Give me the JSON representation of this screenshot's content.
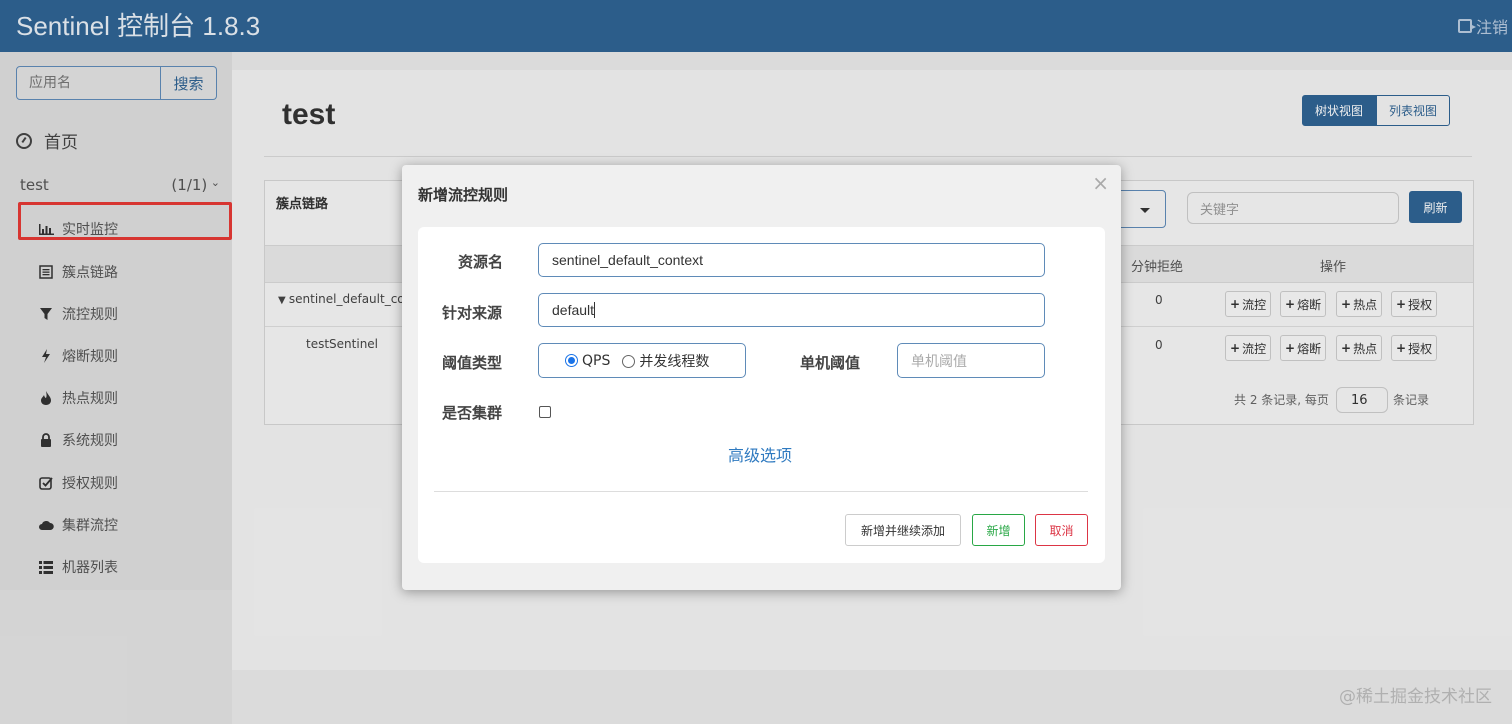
{
  "header": {
    "title": "Sentinel 控制台 1.8.3",
    "logout_label": "注销"
  },
  "sidebar": {
    "search_placeholder": "应用名",
    "search_button": "搜索",
    "home_label": "首页",
    "app": {
      "name": "test",
      "count": "(1/1)"
    },
    "items": [
      {
        "label": "实时监控",
        "icon": "bar-chart-icon"
      },
      {
        "label": "簇点链路",
        "icon": "list-icon"
      },
      {
        "label": "流控规则",
        "icon": "filter-icon"
      },
      {
        "label": "熔断规则",
        "icon": "bolt-icon"
      },
      {
        "label": "热点规则",
        "icon": "fire-icon"
      },
      {
        "label": "系统规则",
        "icon": "lock-icon"
      },
      {
        "label": "授权规则",
        "icon": "check-icon"
      },
      {
        "label": "集群流控",
        "icon": "cloud-icon"
      },
      {
        "label": "机器列表",
        "icon": "th-list-icon"
      }
    ],
    "highlight_color": "#e53935"
  },
  "main": {
    "page_title": "test",
    "view_tree": "树状视图",
    "view_list": "列表视图",
    "panel_title": "簇点链路",
    "keyword_placeholder": "关键字",
    "refresh": "刷新",
    "columns": {
      "reject_per_min": "分钟拒绝",
      "ops": "操作"
    },
    "rows": [
      {
        "name": "sentinel_default_co",
        "reject": "0"
      },
      {
        "name": "testSentinel",
        "reject": "0"
      }
    ],
    "ops": {
      "flow": "流控",
      "degrade": "熔断",
      "hot": "热点",
      "auth": "授权"
    },
    "pager": {
      "prefix": "共 2 条记录, 每页",
      "page_size": "16",
      "suffix": "条记录"
    }
  },
  "modal": {
    "title": "新增流控规则",
    "close": "×",
    "resource_label": "资源名",
    "resource_value": "sentinel_default_context",
    "origin_label": "针对来源",
    "origin_value": "default",
    "threshold_type_label": "阈值类型",
    "option_qps": "QPS",
    "option_threads": "并发线程数",
    "single_threshold_label": "单机阈值",
    "single_threshold_placeholder": "单机阈值",
    "cluster_label": "是否集群",
    "advanced": "高级选项",
    "btn_add_continue": "新增并继续添加",
    "btn_add": "新增",
    "btn_cancel": "取消"
  },
  "watermark": "@稀土掘金技术社区",
  "colors": {
    "header": "#2f6393",
    "add_green": "#28a745",
    "cancel_red": "#dc3545",
    "link_blue": "#2f7ac0"
  }
}
